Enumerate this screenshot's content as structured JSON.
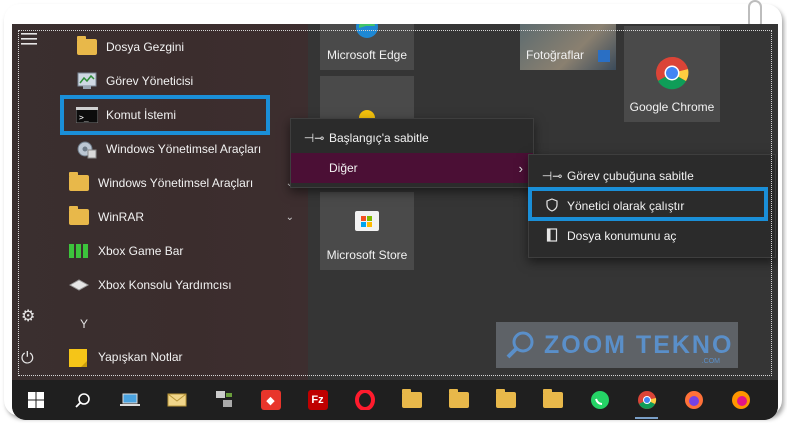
{
  "start_menu": {
    "rail": {
      "menu_icon": "hamburger-icon",
      "settings_icon": "gear-icon",
      "power_icon": "power-icon"
    },
    "apps": [
      {
        "label": "Dosya Gezgini",
        "icon": "file-explorer-icon"
      },
      {
        "label": "Görev Yöneticisi",
        "icon": "task-manager-icon"
      },
      {
        "label": "Komut İstemi",
        "icon": "command-prompt-icon"
      },
      {
        "label": "Windows Yönetimsel Araçları",
        "icon": "admin-tools-icon"
      },
      {
        "label": "Windows Yönetimsel Araçları",
        "icon": "folder-icon"
      },
      {
        "label": "WinRAR",
        "icon": "folder-icon"
      },
      {
        "label": "Xbox Game Bar",
        "icon": "xbox-game-bar-icon"
      },
      {
        "label": "Xbox Konsolu Yardımcısı",
        "icon": "xbox-console-icon"
      },
      {
        "label": "Yapışkan Notlar",
        "icon": "sticky-notes-icon"
      }
    ],
    "section_letter": "Y"
  },
  "tiles": {
    "edge": "Microsoft Edge",
    "photos": "Fotoğraflar",
    "chrome": "Google Chrome",
    "store": "Microsoft Store"
  },
  "context_menu": {
    "items": [
      {
        "label": "Başlangıç'a sabitle",
        "icon": "pin-icon"
      },
      {
        "label": "Diğer",
        "icon": "",
        "arrow": "›"
      }
    ]
  },
  "submenu": {
    "items": [
      {
        "label": "Görev çubuğuna sabitle",
        "icon": "pin-icon"
      },
      {
        "label": "Yönetici olarak çalıştır",
        "icon": "shield-icon"
      },
      {
        "label": "Dosya konumunu aç",
        "icon": "file-location-icon"
      }
    ]
  },
  "watermark": {
    "text": "ZOOM TEKNO",
    "sub": ".COM"
  },
  "highlight_color": "#1a8fd8",
  "taskbar": {
    "items": [
      "windows-start-icon",
      "search-icon",
      "laptop-icon",
      "mail-icon",
      "network-icon",
      "anydesk-icon",
      "filezilla-icon",
      "opera-icon",
      "folder-icon",
      "folder-icon",
      "folder-icon",
      "folder-icon",
      "whatsapp-icon",
      "chrome-icon",
      "firefox-icon",
      "firefox-icon"
    ]
  }
}
